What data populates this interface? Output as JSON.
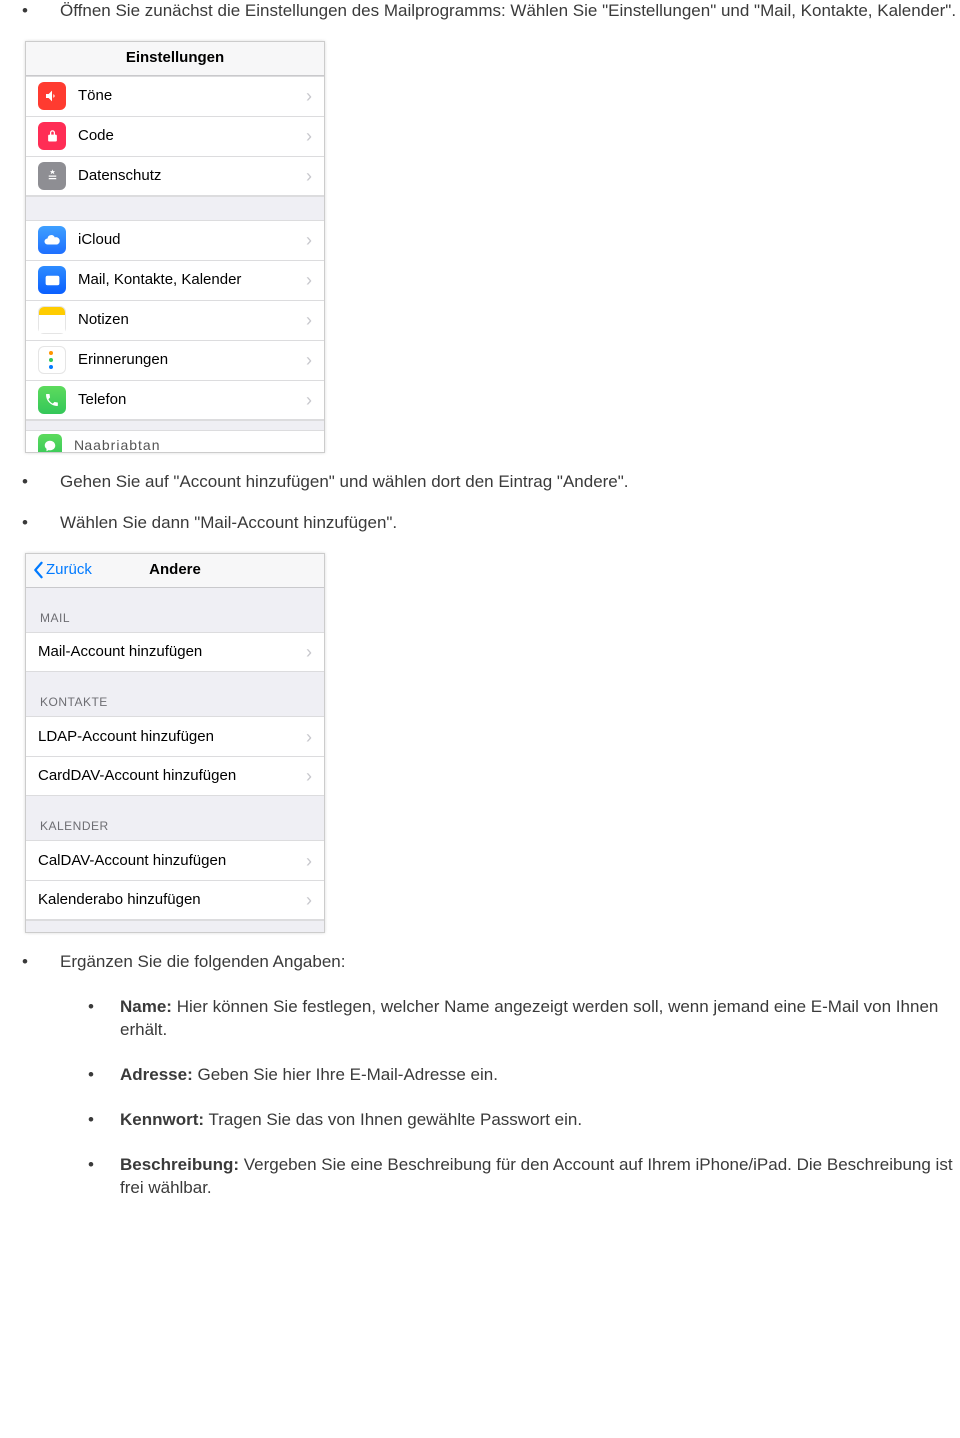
{
  "bullets": {
    "b1": "Öffnen Sie zunächst die Einstellungen des Mailprogramms: Wählen Sie \"Einstellungen\" und \"Mail, Kontakte, Kalender\".",
    "b2": "Gehen Sie auf \"Account hinzufügen\" und wählen dort den Eintrag \"Andere\".",
    "b3": "Wählen Sie dann \"Mail-Account hinzufügen\".",
    "b4": "Ergänzen Sie die folgenden Angaben:"
  },
  "innerBullets": {
    "i1_label": "Name:",
    "i1_text": " Hier können Sie festlegen, welcher Name angezeigt werden soll, wenn jemand eine E-Mail von Ihnen erhält.",
    "i2_label": "Adresse:",
    "i2_text": " Geben Sie hier Ihre E-Mail-Adresse ein.",
    "i3_label": "Kennwort:",
    "i3_text": " Tragen Sie das von Ihnen gewählte Passwort ein.",
    "i4_label": "Beschreibung:",
    "i4_text": " Vergeben Sie eine Beschreibung für den Account auf Ihrem iPhone/iPad. Die Beschreibung ist frei wählbar."
  },
  "shot1": {
    "title": "Einstellungen",
    "rows": {
      "r1": "Töne",
      "r2": "Code",
      "r3": "Datenschutz",
      "r4": "iCloud",
      "r5": "Mail, Kontakte, Kalender",
      "r6": "Notizen",
      "r7": "Erinnerungen",
      "r8": "Telefon",
      "r9": "Nachrichten"
    }
  },
  "shot2": {
    "back": "Zurück",
    "title": "Andere",
    "group1": "MAIL",
    "group2": "KONTAKTE",
    "group3": "KALENDER",
    "rows": {
      "r1": "Mail-Account hinzufügen",
      "r2": "LDAP-Account hinzufügen",
      "r3": "CardDAV-Account hinzufügen",
      "r4": "CalDAV-Account hinzufügen",
      "r5": "Kalenderabo hinzufügen"
    }
  }
}
